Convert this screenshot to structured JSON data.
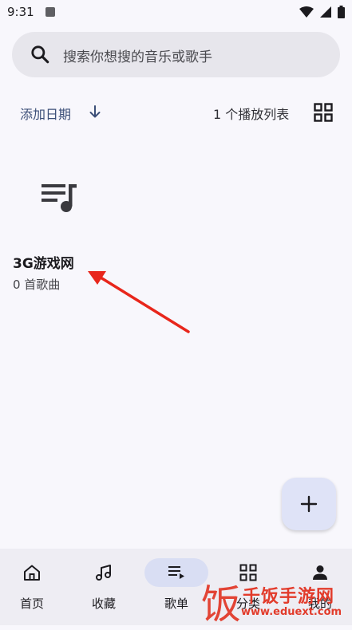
{
  "status_bar": {
    "time": "9:31",
    "icons": [
      "app-a-icon",
      "wifi-icon",
      "signal-icon",
      "battery-icon"
    ]
  },
  "search": {
    "placeholder": "搜索你想搜的音乐或歌手"
  },
  "sort": {
    "label": "添加日期",
    "direction_icon": "arrow-down-icon"
  },
  "playlist_count": "1 个播放列表",
  "playlists": [
    {
      "title": "3G游戏网",
      "subtitle": "0 首歌曲",
      "icon": "playlist-music-icon"
    }
  ],
  "nav": {
    "items": [
      {
        "label": "首页",
        "icon": "home-icon",
        "active": false
      },
      {
        "label": "收藏",
        "icon": "music-note-icon",
        "active": false
      },
      {
        "label": "歌单",
        "icon": "playlist-icon",
        "active": true
      },
      {
        "label": "分类",
        "icon": "grid-icon",
        "active": false
      },
      {
        "label": "我的",
        "icon": "person-icon",
        "active": false
      }
    ]
  },
  "watermark": {
    "glyph": "饭",
    "title": "千饭手游网",
    "url": "www.eduext.com"
  },
  "colors": {
    "background": "#f8f7fc",
    "accent": "#3c4f78",
    "annotation": "#e8261b"
  }
}
